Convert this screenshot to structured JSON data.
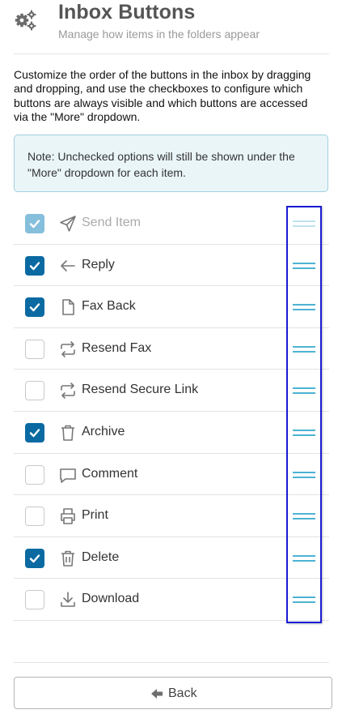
{
  "header": {
    "icon": "gears-icon",
    "title": "Inbox Buttons",
    "subtitle": "Manage how items in the folders appear"
  },
  "description": "Customize the order of the buttons in the inbox by dragging and dropping, and use the checkboxes to configure which buttons are always visible and which buttons are accessed via the \"More\" dropdown.",
  "note": "Note: Unchecked options will still be shown under the \"More\" dropdown for each item.",
  "buttons": [
    {
      "label": "Send Item",
      "icon": "send-icon",
      "checked": true,
      "disabled": true
    },
    {
      "label": "Reply",
      "icon": "arrow-left-icon",
      "checked": true,
      "disabled": false
    },
    {
      "label": "Fax Back",
      "icon": "document-icon",
      "checked": true,
      "disabled": false
    },
    {
      "label": "Resend Fax",
      "icon": "repeat-icon",
      "checked": false,
      "disabled": false
    },
    {
      "label": "Resend Secure Link",
      "icon": "repeat-icon",
      "checked": false,
      "disabled": false
    },
    {
      "label": "Archive",
      "icon": "trash-icon",
      "checked": true,
      "disabled": false
    },
    {
      "label": "Comment",
      "icon": "comment-icon",
      "checked": false,
      "disabled": false
    },
    {
      "label": "Print",
      "icon": "printer-icon",
      "checked": false,
      "disabled": false
    },
    {
      "label": "Delete",
      "icon": "trash-can-icon",
      "checked": true,
      "disabled": false
    },
    {
      "label": "Download",
      "icon": "download-icon",
      "checked": false,
      "disabled": false
    }
  ],
  "footer": {
    "back_label": "Back",
    "back_icon": "arrow-left-icon"
  },
  "colors": {
    "checked": "#0a6aa1",
    "checked_disabled": "#86bfdc",
    "drag_handle": "#4db3d3",
    "note_background": "#eaf5f8",
    "highlight_border": "#1a1ad4"
  }
}
